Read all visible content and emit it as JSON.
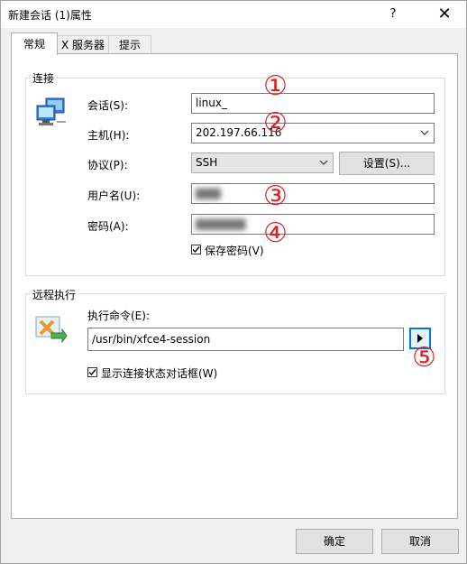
{
  "window": {
    "title": "新建会话 (1)属性",
    "help_glyph": "?",
    "close_glyph": "✕"
  },
  "tabs": [
    {
      "label": "常规",
      "active": true
    },
    {
      "label": "X 服务器",
      "active": false
    },
    {
      "label": "提示",
      "active": false
    }
  ],
  "connection": {
    "group_label": "连接",
    "icon": "network-computer-icon",
    "session_label": "会话(S):",
    "session_value": "linux_",
    "host_label": "主机(H):",
    "host_value": "202.197.66.116",
    "protocol_label": "协议(P):",
    "protocol_value": "SSH",
    "settings_button": "设置(S)...",
    "username_label": "用户名(U):",
    "password_label": "密码(A):",
    "save_password_label": "保存密码(V)",
    "save_password_checked": true
  },
  "remote": {
    "group_label": "远程执行",
    "icon": "xfce-launch-icon",
    "command_label": "执行命令(E):",
    "command_value": "/usr/bin/xfce4-session",
    "show_dialog_label": "显示连接状态对话框(W)",
    "show_dialog_checked": true
  },
  "annotations": [
    "①",
    "②",
    "③",
    "④",
    "⑤"
  ],
  "footer": {
    "ok_label": "确定",
    "cancel_label": "取消"
  },
  "colors": {
    "annotation": "#e02020",
    "focus": "#0078d7"
  }
}
